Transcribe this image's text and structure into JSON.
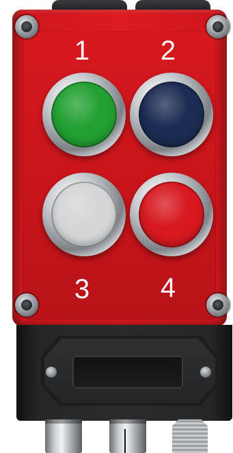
{
  "device": {
    "buttons": [
      {
        "number": "1",
        "color": "#23a032"
      },
      {
        "number": "2",
        "color": "#1c2c52"
      },
      {
        "number": "3",
        "color": "#d4d5d7"
      },
      {
        "number": "4",
        "color": "#d71920"
      }
    ],
    "housing_color": "#d0161d",
    "lower_body_color": "#2a2a2a"
  }
}
